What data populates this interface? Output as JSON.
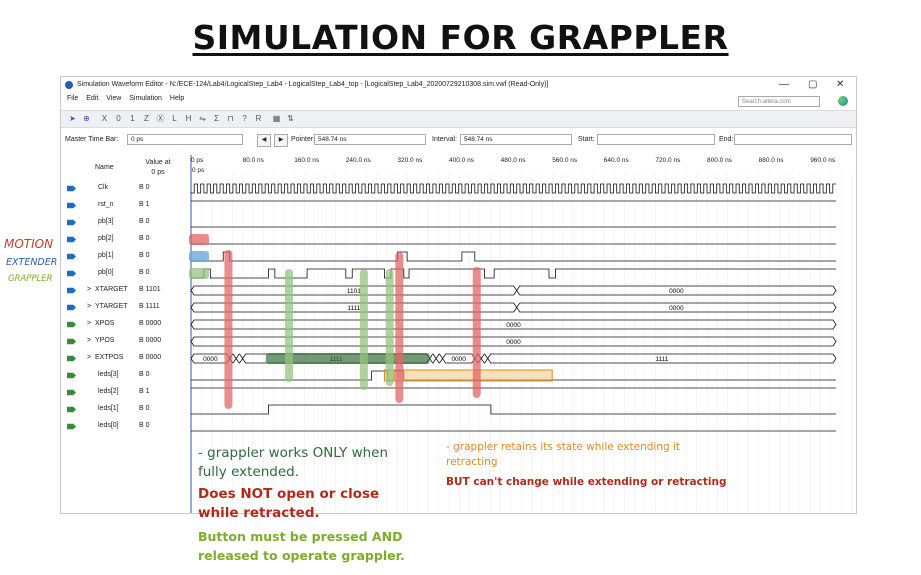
{
  "slide_title": "SIMULATION FOR GRAPPLER",
  "window": {
    "title": "Simulation Waveform Editor - N:/ECE-124/Lab4/LogicalStep_Lab4 - LogicalStep_Lab4_top - [LogicalStep_Lab4_20200729210308.sim.vwf (Read-Only)]",
    "minimize": "—",
    "maximize": "▢",
    "close": "✕"
  },
  "menu": [
    "File",
    "Edit",
    "View",
    "Simulation",
    "Help"
  ],
  "search": {
    "placeholder": "Search altera.com"
  },
  "toolbar_icons": [
    "pointer-tool-icon",
    "zoom-tool-icon",
    "forcing-unknown-icon",
    "forcing-low-icon",
    "forcing-high-icon",
    "forcing-hi-z-icon",
    "weak-unknown-icon",
    "weak-low-icon",
    "weak-high-icon",
    "invert-icon",
    "count-value-icon",
    "clock-icon",
    "arbitrary-value-icon",
    "random-value-icon",
    "snap-to-grid-icon",
    "sort-icon"
  ],
  "timebar": {
    "master_label": "Master Time Bar:",
    "master_value": "0 ps",
    "pointer_label": "Pointer:",
    "pointer_value": "548.74 ns",
    "interval_label": "Interval:",
    "interval_value": "548.74 ns",
    "start_label": "Start:",
    "start_value": "",
    "end_label": "End:",
    "end_value": ""
  },
  "header": {
    "name": "Name",
    "value_at": "Value at",
    "value_at_time": "0 ps",
    "cursor_top": "0 ps",
    "cursor_label": "0 ps"
  },
  "time_ticks": [
    "0 ps",
    "80.0 ns",
    "160.0 ns",
    "240.0 ns",
    "320.0 ns",
    "400.0 ns",
    "480.0 ns",
    "560.0 ns",
    "640.0 ns",
    "720.0 ns",
    "800.0 ns",
    "880.0 ns",
    "960.0 ns"
  ],
  "signals": [
    {
      "name": "Clk",
      "value": "B 0",
      "icon": "input-pin-icon"
    },
    {
      "name": "rst_n",
      "value": "B 1",
      "icon": "input-pin-icon"
    },
    {
      "name": "pb[3]",
      "value": "B 0",
      "icon": "input-pin-icon"
    },
    {
      "name": "pb[2]",
      "value": "B 0",
      "icon": "input-pin-icon"
    },
    {
      "name": "pb[1]",
      "value": "B 0",
      "icon": "input-pin-icon"
    },
    {
      "name": "pb[0]",
      "value": "B 0",
      "icon": "input-pin-icon"
    },
    {
      "name": "XTARGET",
      "value": "B 1101",
      "icon": "input-bus-icon",
      "expand": ">"
    },
    {
      "name": "YTARGET",
      "value": "B 1111",
      "icon": "input-bus-icon",
      "expand": ">"
    },
    {
      "name": "XPOS",
      "value": "B 0000",
      "icon": "output-bus-icon",
      "expand": ">"
    },
    {
      "name": "YPOS",
      "value": "B 0000",
      "icon": "output-bus-icon",
      "expand": ">"
    },
    {
      "name": "EXTPOS",
      "value": "B 0000",
      "icon": "output-bus-icon",
      "expand": ">"
    },
    {
      "name": "leds[3]",
      "value": "B 0",
      "icon": "output-pin-icon"
    },
    {
      "name": "leds[2]",
      "value": "B 1",
      "icon": "output-pin-icon"
    },
    {
      "name": "leds[1]",
      "value": "B 0",
      "icon": "output-pin-icon"
    },
    {
      "name": "leds[0]",
      "value": "B 0",
      "icon": "output-pin-icon"
    }
  ],
  "bus_labels": {
    "xtarget_a": "1101",
    "xtarget_b": "0000",
    "ytarget_a": "1111",
    "ytarget_b": "0000",
    "xpos": "0000",
    "ypos": "0000",
    "extpos_a": "0000",
    "extpos_b": "1111",
    "extpos_c": "0000",
    "extpos_d": "1111"
  },
  "side_labels": {
    "motion": "MOTION",
    "extender": "EXTENDER",
    "grappler": "GRAPPLER"
  },
  "annotations": {
    "green_1": "- grappler works ONLY when",
    "green_2": "fully extended.",
    "red_1": "Does NOT open or close",
    "red_2": "while retracted.",
    "lightgreen_1": "Button must be pressed AND",
    "lightgreen_2": "released to operate grappler.",
    "orange_1": "- grappler retains its state while extending it",
    "orange_2": "retracting",
    "red2_1": "BUT can't change while extending or retracting"
  },
  "colors": {
    "accent_blue": "#2a5db0",
    "highlight_red": "#e06666",
    "highlight_blue": "#6fa8dc",
    "highlight_green": "#93c47d",
    "annot_green": "#2f6b3b",
    "annot_red": "#b12b1d",
    "annot_lightgreen": "#7cae2b",
    "annot_orange": "#e08a24"
  }
}
